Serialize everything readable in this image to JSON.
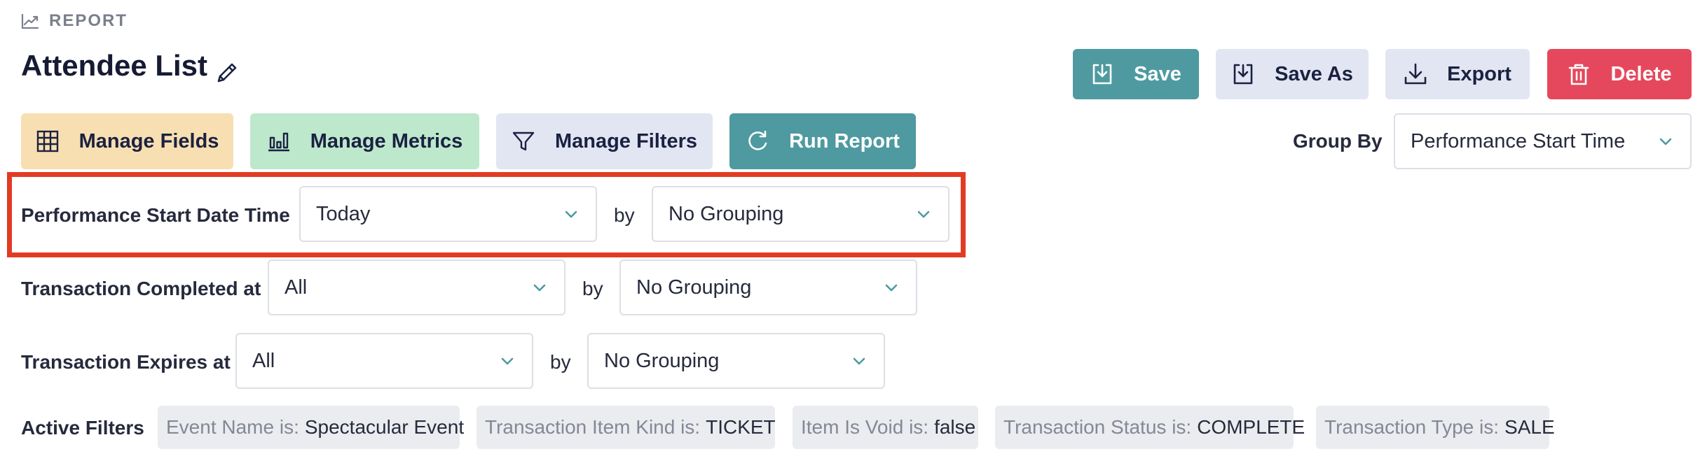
{
  "header": {
    "section_label": "REPORT",
    "title": "Attendee List"
  },
  "actions": {
    "save": "Save",
    "save_as": "Save As",
    "export": "Export",
    "delete": "Delete"
  },
  "toolbar": {
    "manage_fields": "Manage Fields",
    "manage_metrics": "Manage Metrics",
    "manage_filters": "Manage Filters",
    "run_report": "Run Report"
  },
  "group_by": {
    "label": "Group By",
    "value": "Performance Start Time"
  },
  "date_filters": [
    {
      "label": "Performance Start Date Time",
      "range": "Today",
      "by": "by",
      "grouping": "No Grouping"
    },
    {
      "label": "Transaction Completed at",
      "range": "All",
      "by": "by",
      "grouping": "No Grouping"
    },
    {
      "label": "Transaction Expires at",
      "range": "All",
      "by": "by",
      "grouping": "No Grouping"
    }
  ],
  "active_filters": {
    "label": "Active Filters",
    "chips": [
      {
        "key": "Event Name is:",
        "value": "Spectacular Event"
      },
      {
        "key": "Transaction Item Kind is:",
        "value": "TICKET"
      },
      {
        "key": "Item Is Void is:",
        "value": "false"
      },
      {
        "key": "Transaction Status is:",
        "value": "COMPLETE"
      },
      {
        "key": "Transaction Type is:",
        "value": "SALE"
      }
    ]
  },
  "colors": {
    "teal": "#4e9aa0",
    "delete_red": "#e5485c",
    "highlight_red": "#e23b24"
  }
}
